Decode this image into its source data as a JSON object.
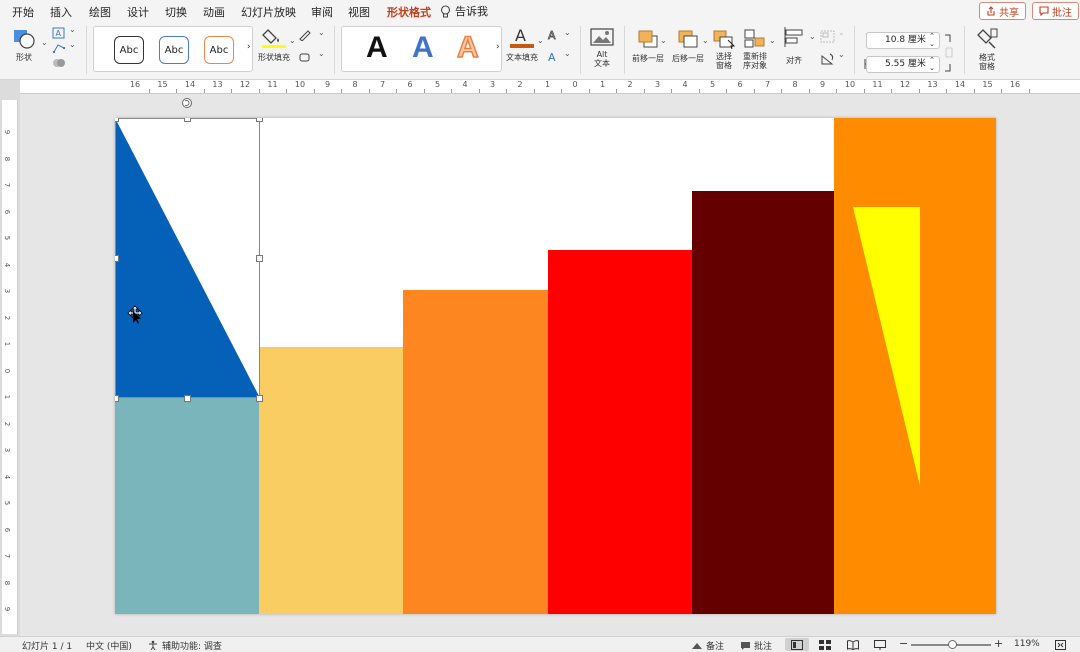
{
  "menu": {
    "tabs": [
      "开始",
      "插入",
      "绘图",
      "设计",
      "切换",
      "动画",
      "幻灯片放映",
      "审阅",
      "视图",
      "形状格式"
    ],
    "active_tab": "形状格式",
    "tell_me": "告诉我",
    "share": "共享",
    "comments": "批注"
  },
  "ribbon": {
    "shape_label": "形状",
    "style_abc": [
      "Abc",
      "Abc",
      "Abc"
    ],
    "shape_fill": "形状填充",
    "wordart_letter": "A",
    "text_fill": "文本填充",
    "alt_text_line1": "Alt",
    "alt_text_line2": "文本",
    "bring_forward": "前移一层",
    "send_backward": "后移一层",
    "selection_pane_line1": "选择",
    "selection_pane_line2": "窗格",
    "reorder_line1": "重新排",
    "reorder_line2": "序对象",
    "align": "对齐",
    "height_value": "10.8 厘米",
    "width_value": "5.55 厘米",
    "format_pane_line1": "格式",
    "format_pane_line2": "窗格"
  },
  "ruler": {
    "h_ticks": [
      "16",
      "15",
      "14",
      "13",
      "12",
      "11",
      "10",
      "9",
      "8",
      "7",
      "6",
      "5",
      "4",
      "3",
      "2",
      "1",
      "0",
      "1",
      "2",
      "3",
      "4",
      "5",
      "6",
      "7",
      "8",
      "9",
      "10",
      "11",
      "12",
      "13",
      "14",
      "15",
      "16"
    ],
    "v_ticks": [
      "9",
      "8",
      "7",
      "6",
      "5",
      "4",
      "3",
      "2",
      "1",
      "0",
      "1",
      "2",
      "3",
      "4",
      "5",
      "6",
      "7",
      "8",
      "9"
    ]
  },
  "slide": {
    "colors": {
      "blue_triangle": "#0560b7",
      "teal": "#7bb5bc",
      "light_yellow": "#f9cd62",
      "orange": "#fd8620",
      "red": "#fe0000",
      "dark_red": "#640000",
      "deep_orange": "#ff8c00",
      "yellow_triangle": "#ffff00"
    }
  },
  "status": {
    "slide_counter": "幻灯片 1 / 1",
    "language": "中文 (中国)",
    "accessibility": "辅助功能: 调查",
    "notes": "备注",
    "comments": "批注",
    "zoom_minus": "−",
    "zoom_plus": "+",
    "zoom_level": "119%"
  }
}
